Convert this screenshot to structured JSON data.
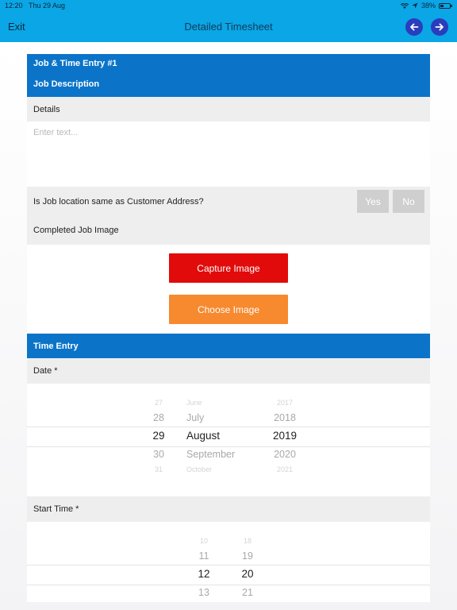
{
  "status_bar": {
    "time": "12:20",
    "date": "Thu 29 Aug",
    "battery": "38%",
    "battery_level": 0.38
  },
  "nav": {
    "exit_label": "Exit",
    "title": "Detailed Timesheet",
    "prev_icon": "arrow-left-icon",
    "next_icon": "arrow-right-icon"
  },
  "job": {
    "header_title": "Job & Time Entry #1",
    "header_subtitle": "Job Description",
    "details_label": "Details",
    "details_placeholder": "Enter text...",
    "details_value": "",
    "location_question": "Is Job location same as Customer Address?",
    "yes_label": "Yes",
    "no_label": "No",
    "image_label": "Completed Job Image",
    "capture_label": "Capture Image",
    "choose_label": "Choose Image"
  },
  "time_entry": {
    "header": "Time Entry",
    "date_label": "Date *",
    "date_picker": {
      "days": [
        "27",
        "28",
        "29",
        "30",
        "31"
      ],
      "months": [
        "June",
        "July",
        "August",
        "September",
        "October"
      ],
      "years": [
        "2017",
        "2018",
        "2019",
        "2020",
        "2021"
      ]
    },
    "start_label": "Start Time *",
    "time_picker": {
      "hours": [
        "10",
        "11",
        "12",
        "13"
      ],
      "minutes": [
        "18",
        "19",
        "20",
        "21"
      ]
    }
  },
  "colors": {
    "nav_bar": "#0aa6e6",
    "section_header": "#0b74c9",
    "arrow_button": "#2a3dbd",
    "capture_button": "#e10b0b",
    "choose_button": "#f7892e",
    "toggle_disabled": "#cfcfcf"
  }
}
